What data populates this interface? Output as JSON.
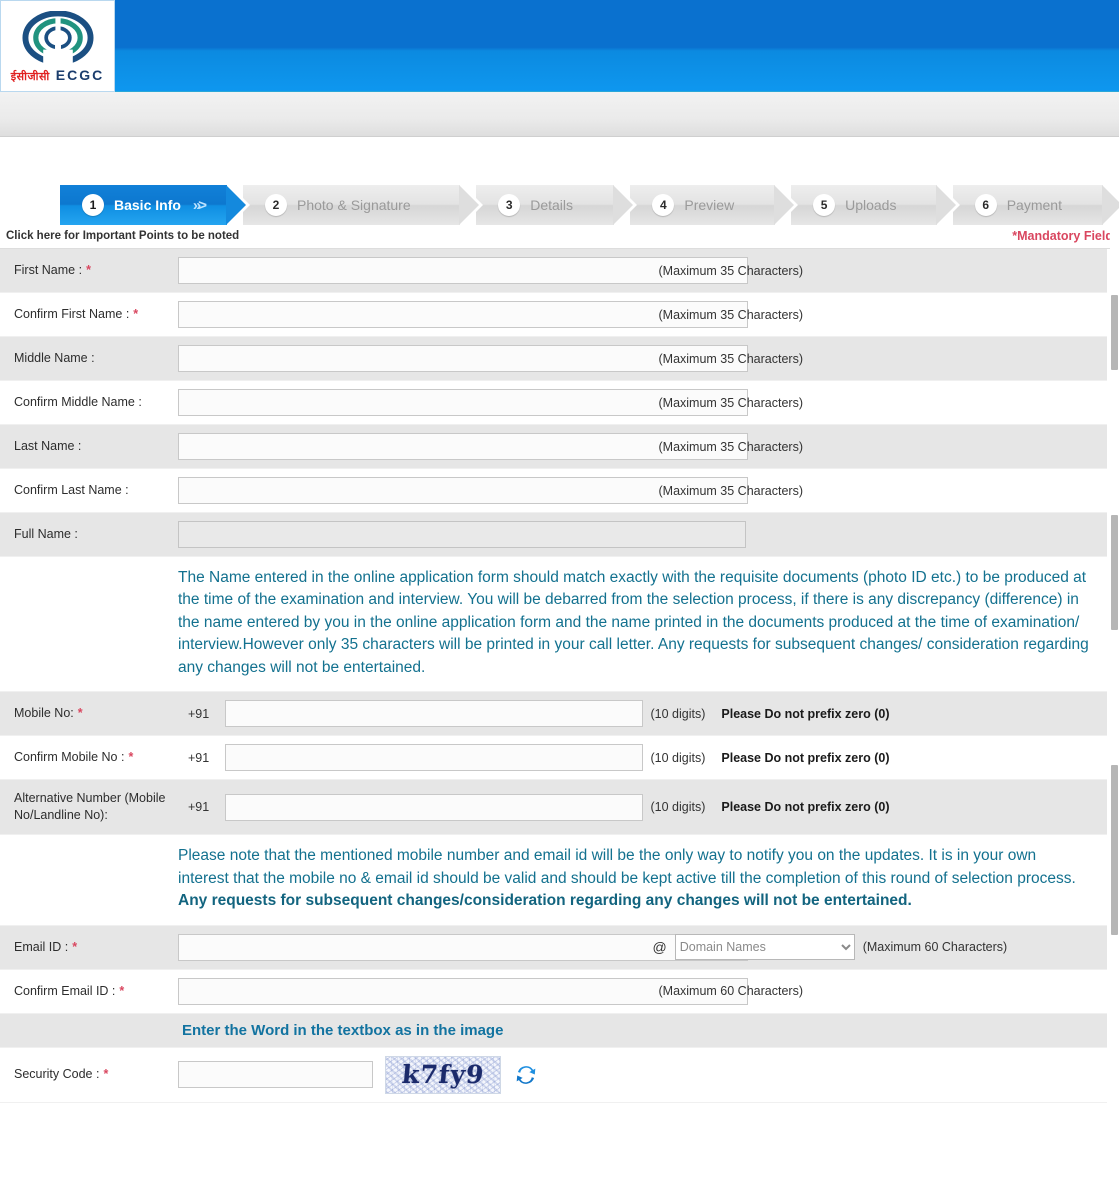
{
  "header": {
    "logo": {
      "hindi_text": "ईसीजीसी",
      "english_text": "ECGC",
      "icon": "ecgc-eye-logo"
    }
  },
  "steps": [
    {
      "num": "1",
      "label": "Basic Info",
      "active": true
    },
    {
      "num": "2",
      "label": "Photo & Signature",
      "active": false
    },
    {
      "num": "3",
      "label": "Details",
      "active": false
    },
    {
      "num": "4",
      "label": "Preview",
      "active": false
    },
    {
      "num": "5",
      "label": "Uploads",
      "active": false
    },
    {
      "num": "6",
      "label": "Payment",
      "active": false
    }
  ],
  "notice": {
    "important_points": "Click here for Important Points to be noted",
    "mandatory": "*Mandatory Field"
  },
  "fields": {
    "first_name": {
      "label": "First Name :",
      "required": true,
      "value": "",
      "hint": "(Maximum 35 Characters)"
    },
    "confirm_first_name": {
      "label": "Confirm First Name :",
      "required": true,
      "value": "",
      "hint": "(Maximum 35 Characters)"
    },
    "middle_name": {
      "label": "Middle Name :",
      "required": false,
      "value": "",
      "hint": "(Maximum 35 Characters)"
    },
    "confirm_middle_name": {
      "label": "Confirm Middle Name :",
      "required": false,
      "value": "",
      "hint": "(Maximum 35 Characters)"
    },
    "last_name": {
      "label": "Last Name :",
      "required": false,
      "value": "",
      "hint": "(Maximum 35 Characters)"
    },
    "confirm_last_name": {
      "label": "Confirm Last Name :",
      "required": false,
      "value": "",
      "hint": "(Maximum 35 Characters)"
    },
    "full_name": {
      "label": "Full Name :",
      "required": false,
      "value": "",
      "hint": ""
    },
    "mobile_no": {
      "label": "Mobile No:",
      "required": true,
      "value": "",
      "country_code": "+91",
      "digits": "(10 digits)",
      "warning": "Please Do not prefix zero (0)"
    },
    "confirm_mobile_no": {
      "label": "Confirm Mobile No :",
      "required": true,
      "value": "",
      "country_code": "+91",
      "digits": "(10 digits)",
      "warning": "Please Do not prefix zero (0)"
    },
    "alternative_number": {
      "label": "Alternative Number (Mobile No/Landline No):",
      "required": false,
      "value": "",
      "country_code": "+91",
      "digits": "(10 digits)",
      "warning": "Please Do not prefix zero (0)"
    },
    "email_id": {
      "label": "Email ID :",
      "required": true,
      "value": "",
      "at": "@",
      "domain_selected": "Domain Names",
      "hint": "(Maximum 60 Characters)"
    },
    "confirm_email_id": {
      "label": "Confirm Email ID :",
      "required": true,
      "value": "",
      "hint": "(Maximum 60 Characters)"
    },
    "security_code": {
      "label": "Security Code :",
      "required": true,
      "value": ""
    }
  },
  "notes": {
    "name_note_part1": "The Name entered in the online application form should match exactly with the requisite documents (photo ID etc.) to be produced at the time of the examination and interview. You will be debarred from the selection process, if there is any discrepancy (difference) in the name entered by you in the online application form and the name printed in the documents produced at the time of examination/ interview.However only 35 characters will be printed in your call letter. Any requests for subsequent changes/ consideration regarding any changes will not be entertained.",
    "contact_note_normal": "Please note that the mentioned mobile number and email id will be the only way to notify you on the updates. It is in your own interest that the mobile no & email id should be valid and should be kept active till the completion of this round of selection process. ",
    "contact_note_bold": "Any requests for subsequent changes/consideration regarding any changes will not be entertained."
  },
  "captcha": {
    "instruction": "Enter the Word in the textbox as in the image",
    "image_text": "k7fy9",
    "refresh_icon": "refresh-icon"
  },
  "colors": {
    "header_blue_top": "#0a71cf",
    "header_blue_bottom": "#0e97ef",
    "accent_step_active": "#1180d8",
    "note_teal": "#13718f",
    "required_red": "#d9465f",
    "row_shade": "#e6e6e6"
  }
}
